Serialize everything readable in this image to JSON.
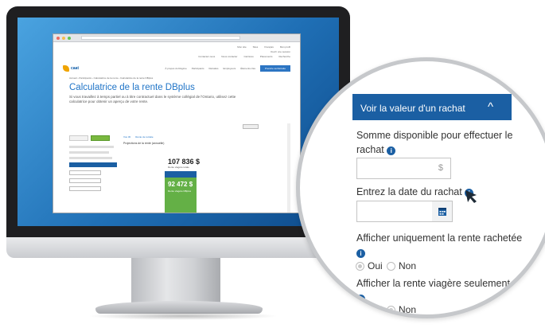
{
  "site": {
    "top_links": [
      "Mon site",
      "Sites",
      "Français",
      "Mon profil"
    ],
    "login_label": "Ouvrir une session",
    "logo_text": "caat",
    "nav_top": [
      "Contactez-nous",
      "Nous contacter",
      "Carrières",
      "Placements",
      "Recherche"
    ],
    "nav_main": [
      "À propos du Régime",
      "Participants",
      "Retraités",
      "Employeurs",
      "Éléments clés"
    ],
    "cta_label": "Prendre sa Retraite",
    "breadcrumb": "Accueil › Participants › Calculatrice de la rente › Calculatrice de la rente DBplus",
    "title": "Calculatrice de la rente DBplus",
    "subtitle": "Si vous travaillez à temps partiel ou à titre contractuel dans le système collégial de l'Ontario, utilisez cette calculatrice pour obtenir un aperçu de votre rente.",
    "tabs": [
      "Vos 30",
      "Rente de retraite"
    ],
    "chart_title": "Projections de la rente (annuelle)",
    "total_value": "107 836 $",
    "total_caption": "Rente viagère totale",
    "green_value": "92 472 $",
    "green_caption": "Rente viagère DBplus"
  },
  "panel": {
    "title": "Voir la valeur d'un rachat",
    "amount_label_line1": "Somme disponible pour effectuer le",
    "amount_label_line2": "rachat",
    "amount_unit": "$",
    "date_label": "Entrez la date du rachat",
    "show_only_label": "Afficher uniquement la rente rachetée",
    "lifetime_label": "Afficher la rente viagère seulement",
    "oui": "Oui",
    "non": "Non",
    "info_glyph": "i",
    "chevron_glyph": "^"
  }
}
